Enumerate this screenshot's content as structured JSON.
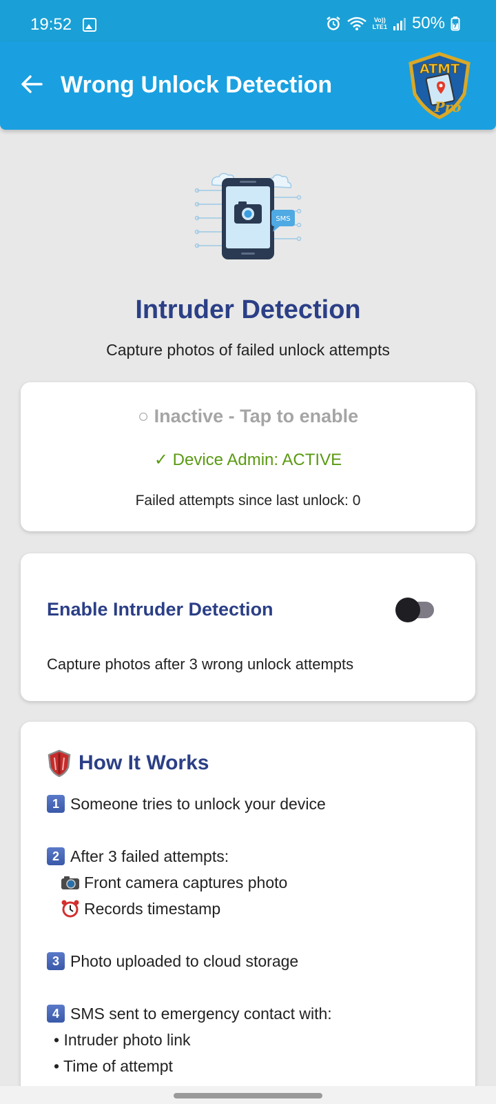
{
  "status_bar": {
    "time": "19:52",
    "battery": "50%",
    "lte_top": "Vo))",
    "lte_bottom": "LTE1"
  },
  "app_bar": {
    "title": "Wrong Unlock Detection",
    "logo_text": "ATMT",
    "logo_sub": "Pro"
  },
  "hero": {
    "title": "Intruder Detection",
    "subtitle": "Capture photos of failed unlock attempts",
    "sms_label": "SMS"
  },
  "status_card": {
    "state": "○ Inactive - Tap to enable",
    "admin": "✓ Device Admin: ACTIVE",
    "failed_attempts": "Failed attempts since last unlock: 0"
  },
  "toggle_card": {
    "title": "Enable Intruder Detection",
    "description": "Capture photos after 3 wrong unlock attempts",
    "enabled": false
  },
  "how_it_works": {
    "title": "How It Works",
    "steps": {
      "s1": {
        "num": "1",
        "text": "Someone tries to unlock your device"
      },
      "s2": {
        "num": "2",
        "text": "After 3 failed attempts:",
        "sub1": "Front camera captures photo",
        "sub2": "Records timestamp"
      },
      "s3": {
        "num": "3",
        "text": "Photo uploaded to cloud storage"
      },
      "s4": {
        "num": "4",
        "text": "SMS sent to emergency contact with:",
        "sub1": "• Intruder photo link",
        "sub2": "• Time of attempt"
      }
    }
  },
  "colors": {
    "primary": "#1aa0e0",
    "heading": "#2b3f86",
    "success": "#5a9a12",
    "muted": "#a5a5a5"
  }
}
